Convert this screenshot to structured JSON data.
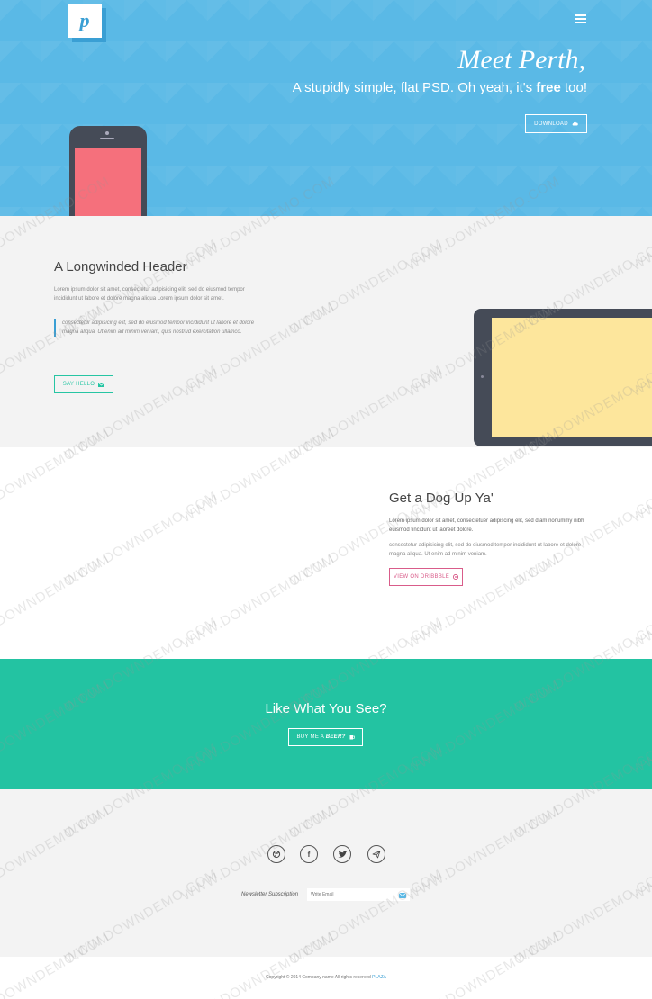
{
  "hero": {
    "logo_letter": "p",
    "title": "Meet Perth,",
    "subtitle_pre": "A stupidly simple, flat PSD. Oh yeah, it's ",
    "subtitle_bold": "free",
    "subtitle_post": " too!",
    "download_label": "DOWNLOAD",
    "colors": {
      "background": "#5ab9e6",
      "phone_screen": "#f5707c"
    }
  },
  "section_longwinded": {
    "heading": "A Longwinded Header",
    "paragraph": "Lorem ipsum dolor sit amet, consectetur adipisicing elit, sed do eiusmod tempor incididunt ut labore et dolore magna aliqua Lorem ipsum dolor sit amet.",
    "quote": "consectetur adipisicing elit, sed do eiusmod tempor incididunt ut labore et dolore magna aliqua. Ut enim ad minim veniam, quis nostrud exercitation ullamco.",
    "button_label": "SAY HELLO",
    "colors": {
      "tablet_screen": "#fde69c",
      "accent": "#26c5a3"
    }
  },
  "section_dog": {
    "heading": "Get a Dog Up Ya'",
    "paragraph1": "Lorem ipsum dolor sit amet, consectetuer adipiscing elit, sed diam nonummy nibh euismod tincidunt ut laoreet dolore.",
    "paragraph2": "consectetur adipisicing elit, sed do eiusmod tempor incididunt ut labore et dolore magna aliqua. Ut enim ad minim veniam.",
    "button_label": "VIEW ON DRIBBBLE",
    "colors": {
      "accent": "#d95c8a"
    }
  },
  "section_like": {
    "heading": "Like What You See?",
    "button_pre": "BUY ME A ",
    "button_bold": "BEER?",
    "colors": {
      "background": "#23c3a2"
    }
  },
  "section_social": {
    "icons": [
      {
        "name": "dribbble-icon",
        "glyph": "◎"
      },
      {
        "name": "facebook-icon",
        "glyph": "f"
      },
      {
        "name": "twitter-icon",
        "glyph": "🐦"
      },
      {
        "name": "send-icon",
        "glyph": "✈"
      }
    ],
    "newsletter_label": "Newsletter Subscription",
    "newsletter_placeholder": "Write Email"
  },
  "footer": {
    "copyright": "Copyright © 2014 Company name All rights reserved ",
    "link": "PLAZA"
  },
  "watermark": "WWW.DOWNDEMO.COM"
}
